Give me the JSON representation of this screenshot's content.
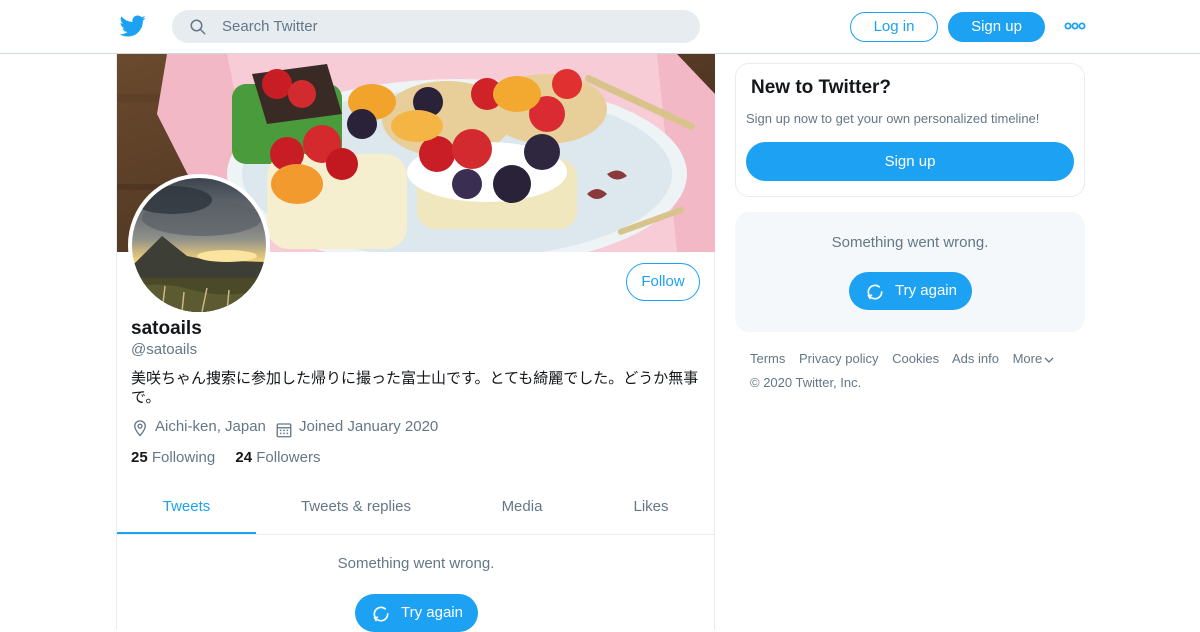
{
  "header": {
    "search_placeholder": "Search Twitter",
    "login_label": "Log in",
    "signup_label": "Sign up"
  },
  "profile": {
    "name": "satoails",
    "handle": "@satoails",
    "bio": "美咲ちゃん捜索に参加した帰りに撮った富士山です。とても綺麗でした。どうか無事で。",
    "location": "Aichi-ken, Japan",
    "joined": "Joined January 2020",
    "following_count": "25",
    "following_label": "Following",
    "followers_count": "24",
    "followers_label": "Followers",
    "follow_label": "Follow"
  },
  "tabs": [
    {
      "label": "Tweets",
      "active": true
    },
    {
      "label": "Tweets & replies",
      "active": false
    },
    {
      "label": "Media",
      "active": false
    },
    {
      "label": "Likes",
      "active": false
    }
  ],
  "timeline_error": {
    "message": "Something went wrong.",
    "retry_label": "Try again"
  },
  "sidebar": {
    "signup_card": {
      "title": "New to Twitter?",
      "subtitle": "Sign up now to get your own personalized timeline!",
      "button_label": "Sign up"
    },
    "error_card": {
      "message": "Something went wrong.",
      "retry_label": "Try again"
    },
    "footer_links": [
      "Terms",
      "Privacy policy",
      "Cookies",
      "Ads info",
      "More"
    ],
    "copyright": "© 2020 Twitter, Inc."
  },
  "icons": {
    "logo": "twitter-bird-icon",
    "search": "search-icon",
    "more": "more-horizontal-icon",
    "location": "location-pin-icon",
    "calendar": "calendar-icon",
    "retry": "refresh-icon",
    "chevron": "chevron-down-icon"
  },
  "colors": {
    "accent": "#1da1f2",
    "secondary_text": "#657786",
    "panel_bg": "#f5f8fa"
  }
}
